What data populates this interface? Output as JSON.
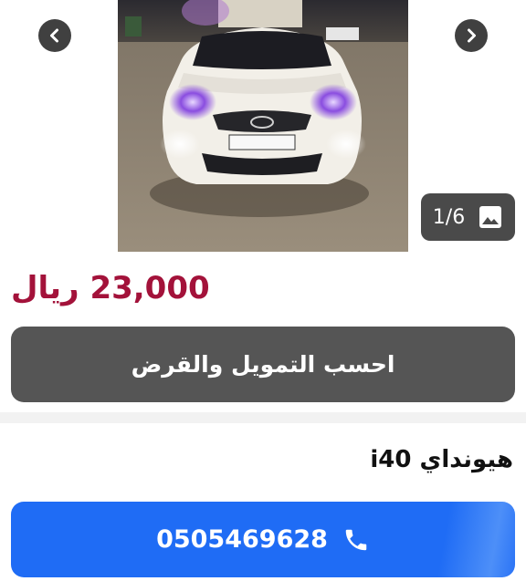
{
  "gallery": {
    "counter": "1/6",
    "prev_icon": "chevron-left-icon",
    "next_icon": "chevron-right-icon",
    "image_icon": "image-icon"
  },
  "listing": {
    "price": "23,000 ريال",
    "finance_button": "احسب التمويل والقرض",
    "title": "هيونداي i40",
    "phone": "0505469628"
  },
  "colors": {
    "price": "#a3123a",
    "finance_button": "#555555",
    "phone_button": "#1f6cf5"
  }
}
